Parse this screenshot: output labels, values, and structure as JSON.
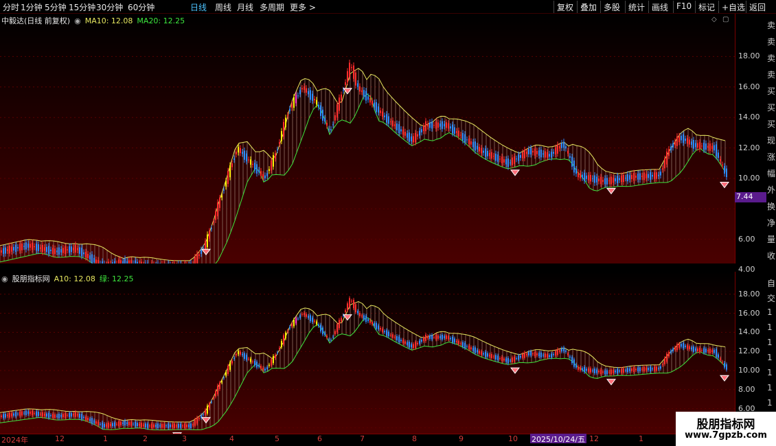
{
  "toolbar": {
    "periods": [
      "分时",
      "1分钟",
      "5分钟",
      "15分钟",
      "30分钟",
      "60分钟",
      "日线",
      "周线",
      "月线",
      "多周期",
      "更多 >"
    ],
    "active_period": "日线",
    "right_buttons": [
      "复权",
      "叠加",
      "多股",
      "统计",
      "画线",
      "F10",
      "标记",
      "+自选",
      "返回"
    ]
  },
  "panel1": {
    "stock_title": "中毅达(日线 前复权)",
    "ma10_label": "MA10: 12.08",
    "ma20_label": "MA20: 12.25",
    "ylabels": [
      "18.00",
      "16.00",
      "14.00",
      "12.00",
      "10.00",
      "6.00",
      "4.00"
    ],
    "price_tag": "7.44",
    "right_glyphs": [
      "卖",
      "卖",
      "卖",
      "卖",
      "买",
      "买",
      "买",
      "现",
      "涨",
      "幅",
      "外",
      "换",
      "净",
      "量",
      "收"
    ]
  },
  "panel2": {
    "indicator_title": "股朋指标网",
    "a10_label": "A10: 12.08",
    "green_label": "绿: 12.25",
    "ylabels": [
      "18.00",
      "16.00",
      "14.00",
      "12.00",
      "10.00",
      "8.00",
      "6.00"
    ],
    "right_glyphs": [
      "自",
      "交",
      "1",
      "1",
      "1",
      "1",
      "1",
      "1",
      "1",
      "1",
      "1"
    ]
  },
  "xaxis": {
    "labels": [
      "2024年",
      "12",
      "1",
      "2",
      "3",
      "4",
      "5",
      "6",
      "7",
      "8",
      "9",
      "10",
      "12",
      "1"
    ],
    "cursor_date": "2025/10/24/五"
  },
  "watermark": {
    "line1": "股朋指标网",
    "line2": "www.7gpzb.com"
  },
  "colors": {
    "up": "#ff2b2b",
    "down": "#2a8cff",
    "yellow": "#ffee00",
    "magenta": "#ff30c8",
    "upper_band": "#e8e860",
    "lower_band": "#3ee83e",
    "accent": "#4cc3ff"
  }
}
